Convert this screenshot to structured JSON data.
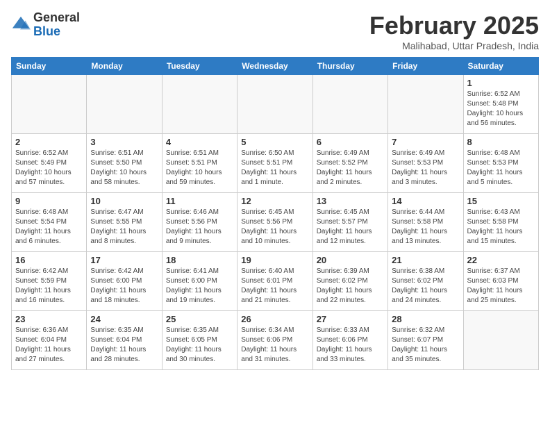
{
  "header": {
    "logo_general": "General",
    "logo_blue": "Blue",
    "month_title": "February 2025",
    "location": "Malihabad, Uttar Pradesh, India"
  },
  "weekdays": [
    "Sunday",
    "Monday",
    "Tuesday",
    "Wednesday",
    "Thursday",
    "Friday",
    "Saturday"
  ],
  "weeks": [
    [
      {
        "day": "",
        "info": ""
      },
      {
        "day": "",
        "info": ""
      },
      {
        "day": "",
        "info": ""
      },
      {
        "day": "",
        "info": ""
      },
      {
        "day": "",
        "info": ""
      },
      {
        "day": "",
        "info": ""
      },
      {
        "day": "1",
        "info": "Sunrise: 6:52 AM\nSunset: 5:48 PM\nDaylight: 10 hours\nand 56 minutes."
      }
    ],
    [
      {
        "day": "2",
        "info": "Sunrise: 6:52 AM\nSunset: 5:49 PM\nDaylight: 10 hours\nand 57 minutes."
      },
      {
        "day": "3",
        "info": "Sunrise: 6:51 AM\nSunset: 5:50 PM\nDaylight: 10 hours\nand 58 minutes."
      },
      {
        "day": "4",
        "info": "Sunrise: 6:51 AM\nSunset: 5:51 PM\nDaylight: 10 hours\nand 59 minutes."
      },
      {
        "day": "5",
        "info": "Sunrise: 6:50 AM\nSunset: 5:51 PM\nDaylight: 11 hours\nand 1 minute."
      },
      {
        "day": "6",
        "info": "Sunrise: 6:49 AM\nSunset: 5:52 PM\nDaylight: 11 hours\nand 2 minutes."
      },
      {
        "day": "7",
        "info": "Sunrise: 6:49 AM\nSunset: 5:53 PM\nDaylight: 11 hours\nand 3 minutes."
      },
      {
        "day": "8",
        "info": "Sunrise: 6:48 AM\nSunset: 5:53 PM\nDaylight: 11 hours\nand 5 minutes."
      }
    ],
    [
      {
        "day": "9",
        "info": "Sunrise: 6:48 AM\nSunset: 5:54 PM\nDaylight: 11 hours\nand 6 minutes."
      },
      {
        "day": "10",
        "info": "Sunrise: 6:47 AM\nSunset: 5:55 PM\nDaylight: 11 hours\nand 8 minutes."
      },
      {
        "day": "11",
        "info": "Sunrise: 6:46 AM\nSunset: 5:56 PM\nDaylight: 11 hours\nand 9 minutes."
      },
      {
        "day": "12",
        "info": "Sunrise: 6:45 AM\nSunset: 5:56 PM\nDaylight: 11 hours\nand 10 minutes."
      },
      {
        "day": "13",
        "info": "Sunrise: 6:45 AM\nSunset: 5:57 PM\nDaylight: 11 hours\nand 12 minutes."
      },
      {
        "day": "14",
        "info": "Sunrise: 6:44 AM\nSunset: 5:58 PM\nDaylight: 11 hours\nand 13 minutes."
      },
      {
        "day": "15",
        "info": "Sunrise: 6:43 AM\nSunset: 5:58 PM\nDaylight: 11 hours\nand 15 minutes."
      }
    ],
    [
      {
        "day": "16",
        "info": "Sunrise: 6:42 AM\nSunset: 5:59 PM\nDaylight: 11 hours\nand 16 minutes."
      },
      {
        "day": "17",
        "info": "Sunrise: 6:42 AM\nSunset: 6:00 PM\nDaylight: 11 hours\nand 18 minutes."
      },
      {
        "day": "18",
        "info": "Sunrise: 6:41 AM\nSunset: 6:00 PM\nDaylight: 11 hours\nand 19 minutes."
      },
      {
        "day": "19",
        "info": "Sunrise: 6:40 AM\nSunset: 6:01 PM\nDaylight: 11 hours\nand 21 minutes."
      },
      {
        "day": "20",
        "info": "Sunrise: 6:39 AM\nSunset: 6:02 PM\nDaylight: 11 hours\nand 22 minutes."
      },
      {
        "day": "21",
        "info": "Sunrise: 6:38 AM\nSunset: 6:02 PM\nDaylight: 11 hours\nand 24 minutes."
      },
      {
        "day": "22",
        "info": "Sunrise: 6:37 AM\nSunset: 6:03 PM\nDaylight: 11 hours\nand 25 minutes."
      }
    ],
    [
      {
        "day": "23",
        "info": "Sunrise: 6:36 AM\nSunset: 6:04 PM\nDaylight: 11 hours\nand 27 minutes."
      },
      {
        "day": "24",
        "info": "Sunrise: 6:35 AM\nSunset: 6:04 PM\nDaylight: 11 hours\nand 28 minutes."
      },
      {
        "day": "25",
        "info": "Sunrise: 6:35 AM\nSunset: 6:05 PM\nDaylight: 11 hours\nand 30 minutes."
      },
      {
        "day": "26",
        "info": "Sunrise: 6:34 AM\nSunset: 6:06 PM\nDaylight: 11 hours\nand 31 minutes."
      },
      {
        "day": "27",
        "info": "Sunrise: 6:33 AM\nSunset: 6:06 PM\nDaylight: 11 hours\nand 33 minutes."
      },
      {
        "day": "28",
        "info": "Sunrise: 6:32 AM\nSunset: 6:07 PM\nDaylight: 11 hours\nand 35 minutes."
      },
      {
        "day": "",
        "info": ""
      }
    ]
  ]
}
